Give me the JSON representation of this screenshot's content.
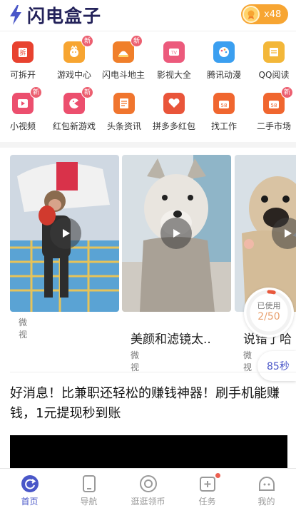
{
  "header": {
    "app_name": "闪电盒子",
    "coin_count": "x48",
    "brand_color": "#23225a",
    "coin_color": "#f7a532"
  },
  "grid": {
    "row1": [
      {
        "label": "可拆开",
        "icon": "gift-box-icon",
        "color": "#e8422f",
        "new": false
      },
      {
        "label": "游戏中心",
        "icon": "game-mascot-icon",
        "color": "#f7a531",
        "new": true,
        "badge": "新"
      },
      {
        "label": "闪电斗地主",
        "icon": "landlord-hat-icon",
        "color": "#f07f2a",
        "new": true,
        "badge": "新"
      },
      {
        "label": "影视大全",
        "icon": "tv-icon",
        "color": "#ec5a7c",
        "new": false
      },
      {
        "label": "腾讯动漫",
        "icon": "palette-icon",
        "color": "#3b9ff0",
        "new": false
      },
      {
        "label": "QQ阅读",
        "icon": "book-icon",
        "color": "#f3b739",
        "new": false
      }
    ],
    "row2": [
      {
        "label": "小视频",
        "icon": "play-video-icon",
        "color": "#ec4f6e",
        "new": true,
        "badge": "新"
      },
      {
        "label": "红包新游戏",
        "icon": "pacman-icon",
        "color": "#ec4f6e",
        "new": true,
        "badge": "新"
      },
      {
        "label": "头条资讯",
        "icon": "news-document-icon",
        "color": "#f0752e",
        "new": false
      },
      {
        "label": "拼多多红包",
        "icon": "heart-shopping-icon",
        "color": "#e9553a",
        "new": false
      },
      {
        "label": "找工作",
        "icon": "job-bag-icon",
        "color": "#f0662f",
        "new": false,
        "bag_text": "58"
      },
      {
        "label": "二手市场",
        "icon": "market-bag-icon",
        "color": "#f0662f",
        "new": true,
        "badge": "新",
        "bag_text": "58"
      }
    ]
  },
  "videos": [
    {
      "title": "",
      "source": "微视",
      "thumb": "monkey-thumbnail"
    },
    {
      "title": "美颜和滤镜太..",
      "source": "微视",
      "thumb": "husky-dog-thumbnail"
    },
    {
      "title": "说错了哈",
      "source": "微视",
      "thumb": "pug-dog-thumbnail"
    }
  ],
  "timer": {
    "label": "已使用",
    "count": "2/50",
    "progress": 0.04,
    "countdown": "85秒"
  },
  "news": {
    "headline": "好消息！比兼职还轻松的赚钱神器！刷手机能赚钱，1元提现秒到账"
  },
  "bottom_nav": [
    {
      "label": "首页",
      "icon": "home-refresh-icon",
      "active": true
    },
    {
      "label": "导航",
      "icon": "phone-navigation-icon",
      "active": false
    },
    {
      "label": "逛逛领币",
      "icon": "coin-browse-icon",
      "active": false
    },
    {
      "label": "任务",
      "icon": "calendar-task-icon",
      "active": false,
      "dot": true
    },
    {
      "label": "我的",
      "icon": "profile-face-icon",
      "active": false
    }
  ],
  "colors": {
    "accent": "#4a57c8",
    "badge_red": "#ec5f70",
    "inactive_nav": "#9a9a9a"
  }
}
